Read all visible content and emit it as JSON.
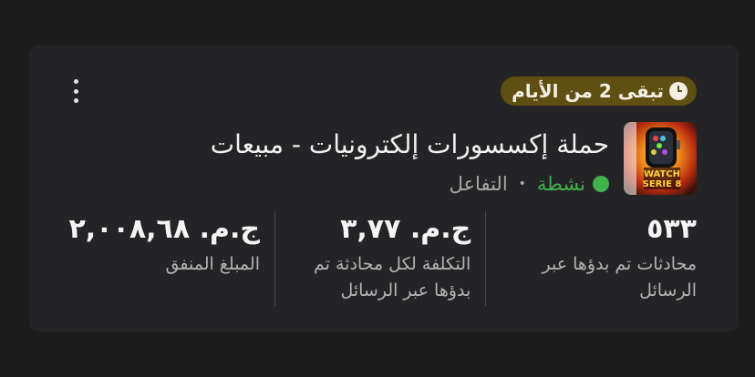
{
  "campaign": {
    "days_left_badge": "تبقى 2 من الأيام",
    "title": "حملة إكسسورات إلكترونيات - مبيعات",
    "status": "نشطة",
    "delivery_label": "التفاعل",
    "thumbnail_text": [
      "WATCH",
      "SERIE 8"
    ]
  },
  "metrics": [
    {
      "value": "٥٣٣",
      "label": "محادثات تم بدؤها عبر الرسائل"
    },
    {
      "value": "ج.م. ٣,٧٧",
      "label": "التكلفة لكل محادثة تم بدؤها عبر الرسائل"
    },
    {
      "value": "ج.م. ٢,٠٠٨,٦٨",
      "label": "المبلغ المنفق"
    }
  ],
  "colors": {
    "badge_bg": "#5f4f12",
    "active_green": "#3fb34a",
    "card_bg": "#242426"
  },
  "icons": {
    "badge": "clock-icon",
    "menu": "more-vertical-icon"
  }
}
